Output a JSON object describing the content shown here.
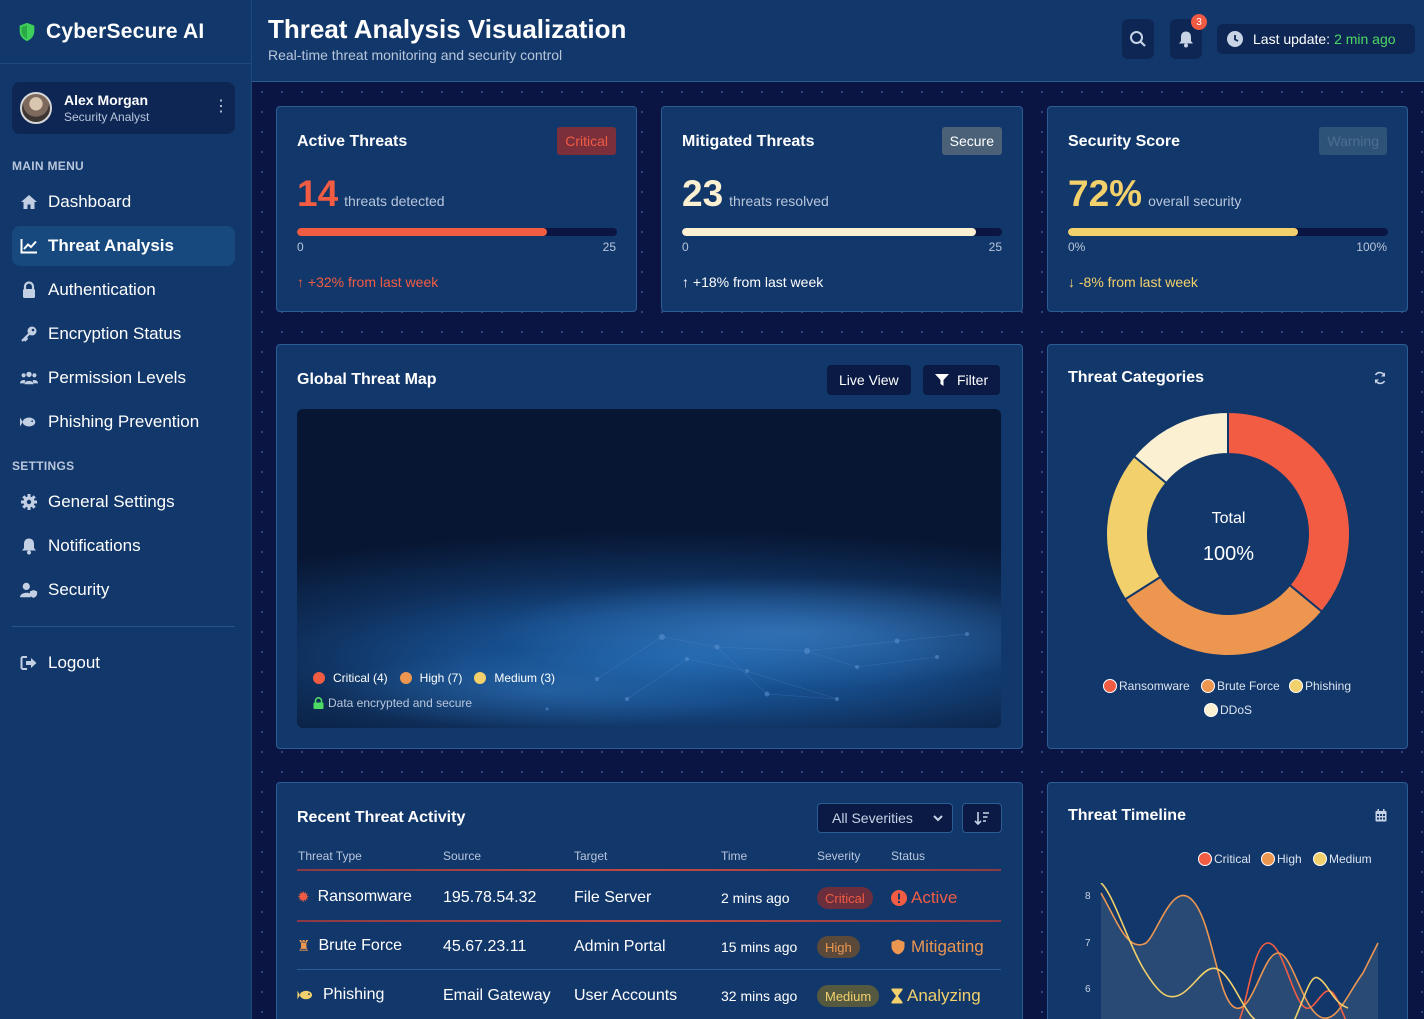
{
  "app": {
    "name": "CyberSecure AI"
  },
  "user": {
    "name": "Alex Morgan",
    "role": "Security Analyst"
  },
  "menu": {
    "main_label": "MAIN MENU",
    "items": [
      {
        "label": "Dashboard",
        "icon": "home-icon"
      },
      {
        "label": "Threat Analysis",
        "icon": "chart-line-icon",
        "active": true
      },
      {
        "label": "Authentication",
        "icon": "lock-icon"
      },
      {
        "label": "Encryption Status",
        "icon": "key-icon"
      },
      {
        "label": "Permission Levels",
        "icon": "users-icon"
      },
      {
        "label": "Phishing Prevention",
        "icon": "fish-icon"
      }
    ],
    "settings_label": "SETTINGS",
    "settings": [
      {
        "label": "General Settings",
        "icon": "gear-icon"
      },
      {
        "label": "Notifications",
        "icon": "bell-icon"
      },
      {
        "label": "Security",
        "icon": "user-shield-icon"
      }
    ],
    "logout": "Logout"
  },
  "header": {
    "title": "Threat Analysis Visualization",
    "subtitle": "Real-time threat monitoring and security control",
    "notif_count": "3",
    "update_label": "Last update:",
    "update_value": "2 min ago"
  },
  "stats": [
    {
      "title": "Active Threats",
      "tag": "Critical",
      "value": "14",
      "unit": "threats detected",
      "min": "0",
      "max": "25",
      "fill": 0.78,
      "trend": "+32% from last week",
      "trend_dir": "up"
    },
    {
      "title": "Mitigated Threats",
      "tag": "Secure",
      "value": "23",
      "unit": "threats resolved",
      "min": "0",
      "max": "25",
      "fill": 0.92,
      "trend": "+18% from last week",
      "trend_dir": "up"
    },
    {
      "title": "Security Score",
      "tag": "Warning",
      "value": "72%",
      "unit": "overall security",
      "min": "0%",
      "max": "100%",
      "fill": 0.72,
      "trend": "-8% from last week",
      "trend_dir": "down"
    }
  ],
  "map": {
    "title": "Global Threat Map",
    "live_view": "Live View",
    "filter": "Filter",
    "legend": [
      "Critical (4)",
      "High (7)",
      "Medium (3)"
    ],
    "secure_note": "Data encrypted and secure"
  },
  "categories": {
    "title": "Threat Categories",
    "center_label": "Total",
    "center_value": "100%",
    "legend": [
      "Ransomware",
      "Brute Force",
      "Phishing",
      "DDoS"
    ]
  },
  "activity": {
    "title": "Recent Threat Activity",
    "filter": "All Severities",
    "columns": [
      "Threat Type",
      "Source",
      "Target",
      "Time",
      "Severity",
      "Status"
    ],
    "rows": [
      {
        "type": "Ransomware",
        "source": "195.78.54.32",
        "target": "File Server",
        "time": "2 mins ago",
        "severity": "Critical",
        "status": "Active"
      },
      {
        "type": "Brute Force",
        "source": "45.67.23.11",
        "target": "Admin Portal",
        "time": "15 mins ago",
        "severity": "High",
        "status": "Mitigating"
      },
      {
        "type": "Phishing",
        "source": "Email Gateway",
        "target": "User Accounts",
        "time": "32 mins ago",
        "severity": "Medium",
        "status": "Analyzing"
      }
    ]
  },
  "timeline": {
    "title": "Threat Timeline",
    "legend": [
      "Critical",
      "High",
      "Medium"
    ],
    "y_ticks": [
      "8",
      "7",
      "6"
    ]
  },
  "colors": {
    "critical": "#f25c43",
    "high": "#ec9650",
    "medium": "#f2d06b",
    "ddos": "#fbf0d2",
    "green": "#4cd964"
  }
}
